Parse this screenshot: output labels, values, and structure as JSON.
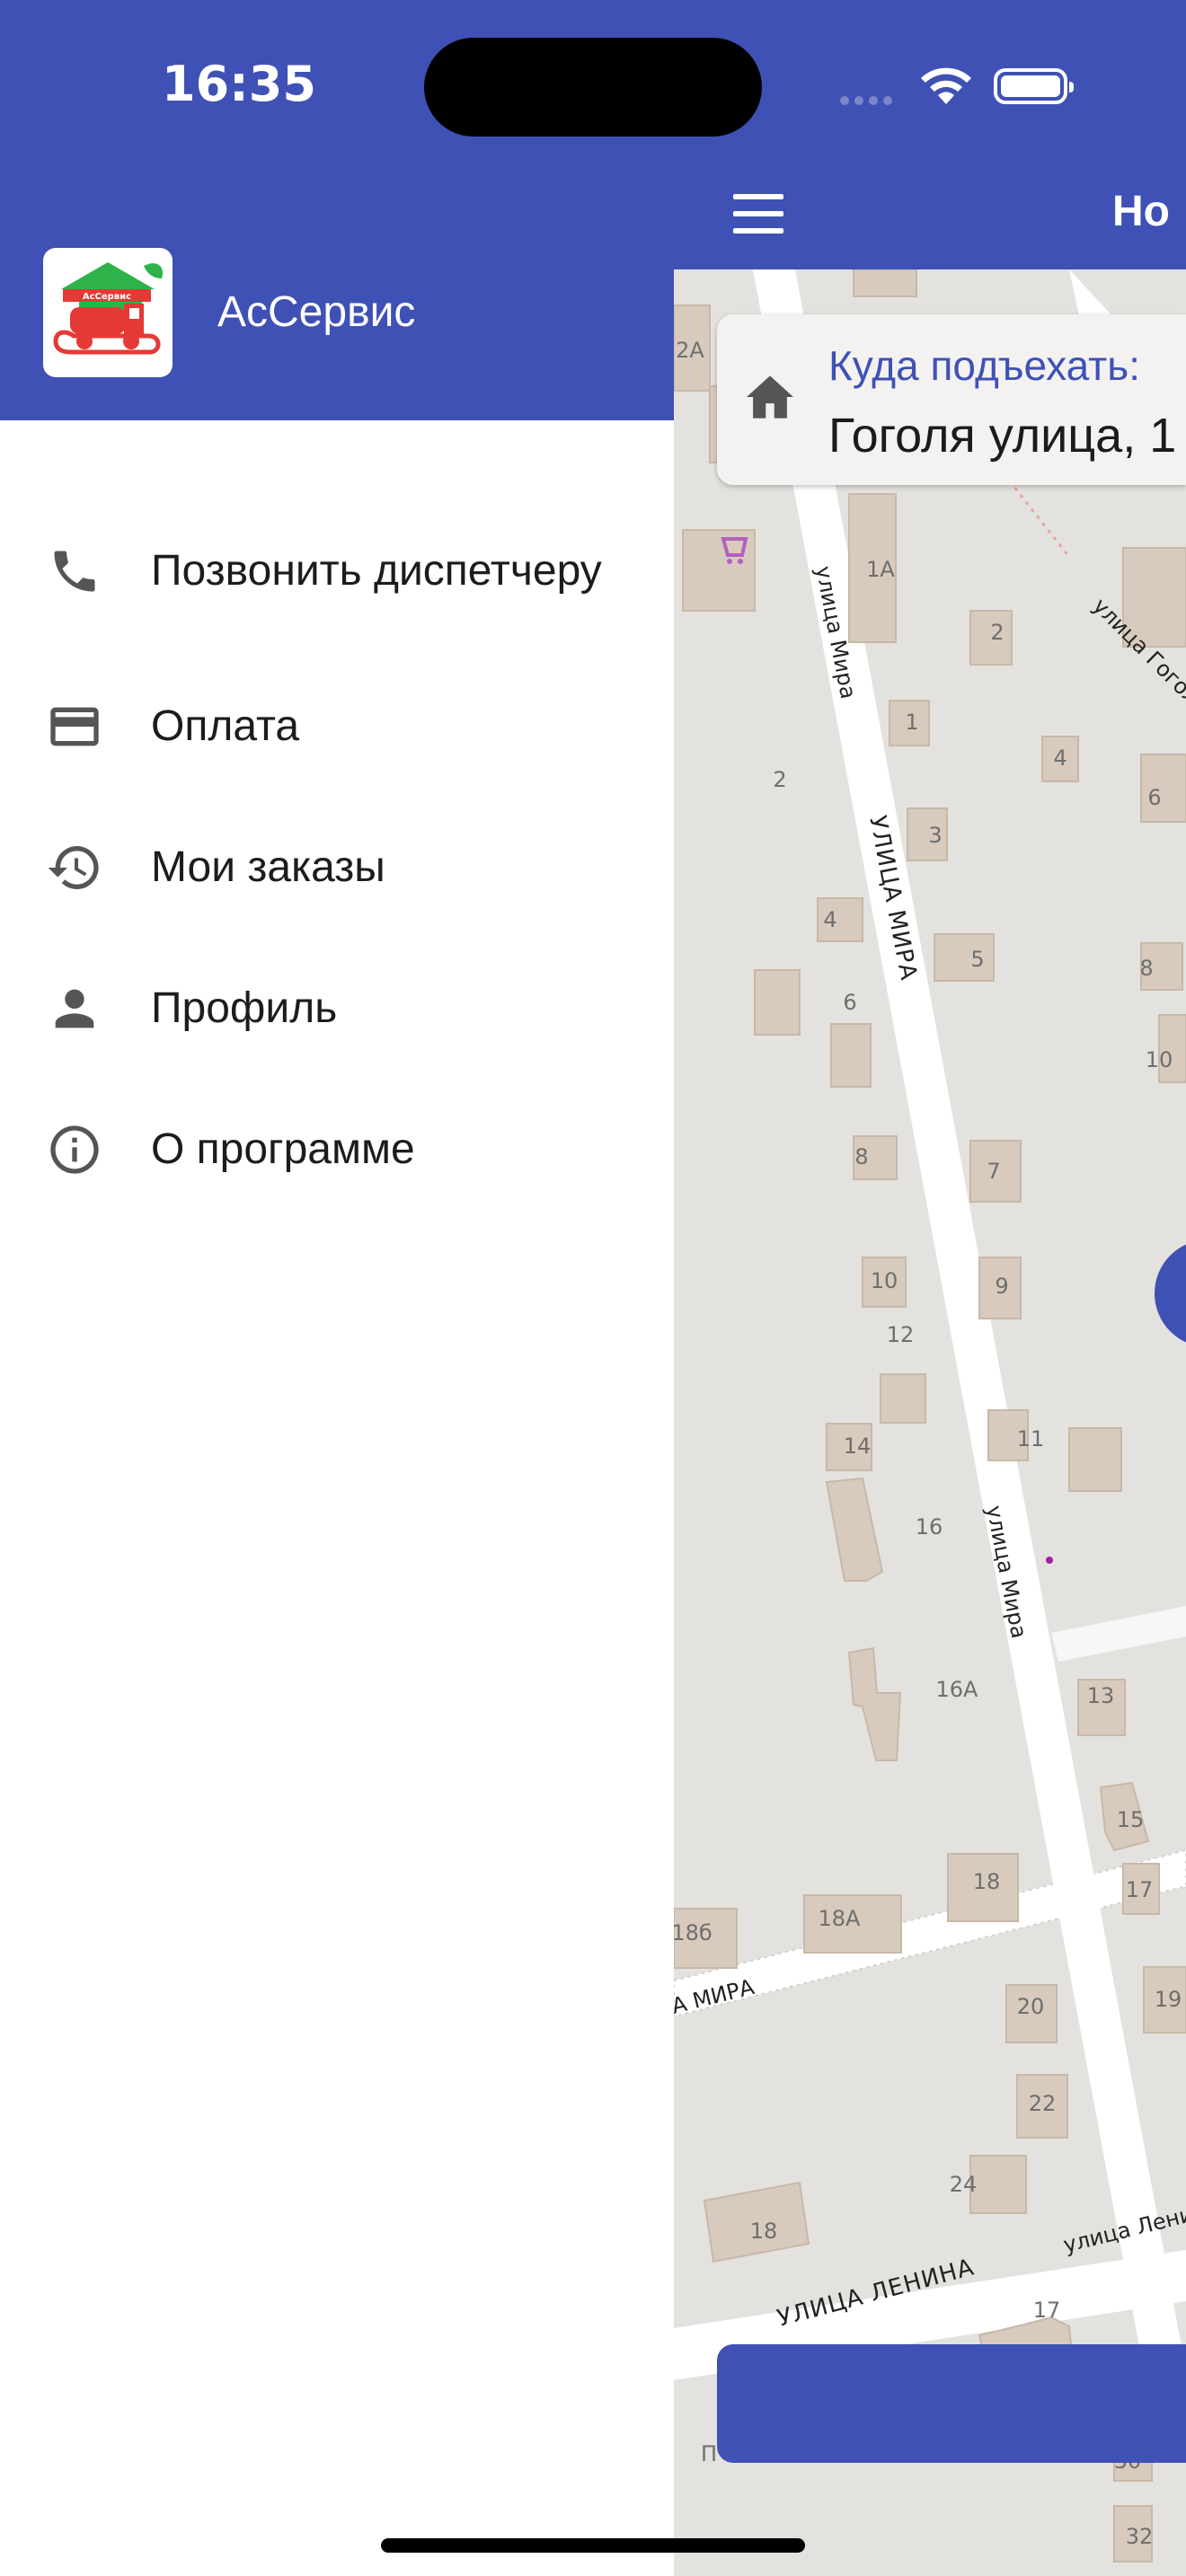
{
  "status_bar": {
    "time": "16:35"
  },
  "app_bar": {
    "title": "Ho"
  },
  "address_card": {
    "label": "Куда подъехать:",
    "value": "Гоголя улица, 1"
  },
  "drawer": {
    "brand": "АсСервис",
    "logo_text": "АсСервис",
    "items": [
      {
        "label": "Позвонить диспетчеру",
        "icon": "phone-icon"
      },
      {
        "label": "Оплата",
        "icon": "credit-card-icon"
      },
      {
        "label": "Мои заказы",
        "icon": "history-icon"
      },
      {
        "label": "Профиль",
        "icon": "person-icon"
      },
      {
        "label": "О программе",
        "icon": "info-icon"
      }
    ]
  },
  "map": {
    "streets": [
      "улица Мира",
      "УЛИЦА МИРА",
      "улица Мира",
      "улица Гоголя",
      "УЛИЦА ЛЕНИНА",
      "улица Ленина",
      "УЛИЦА МИРА"
    ],
    "houses": [
      "2A",
      "1A",
      "1",
      "2",
      "2",
      "3",
      "4",
      "4",
      "5",
      "6",
      "6",
      "7",
      "8",
      "8",
      "9",
      "10",
      "10",
      "11",
      "12",
      "13",
      "14",
      "15",
      "16",
      "16А",
      "17",
      "17",
      "18",
      "18А",
      "18б",
      "18",
      "19",
      "20",
      "22",
      "24",
      "30",
      "32"
    ]
  },
  "colors": {
    "primary": "#3f51b5",
    "drawer_bg": "#ffffff",
    "map_bg": "#e4e2df",
    "road": "#ffffff",
    "building": "#d8cbbd"
  }
}
